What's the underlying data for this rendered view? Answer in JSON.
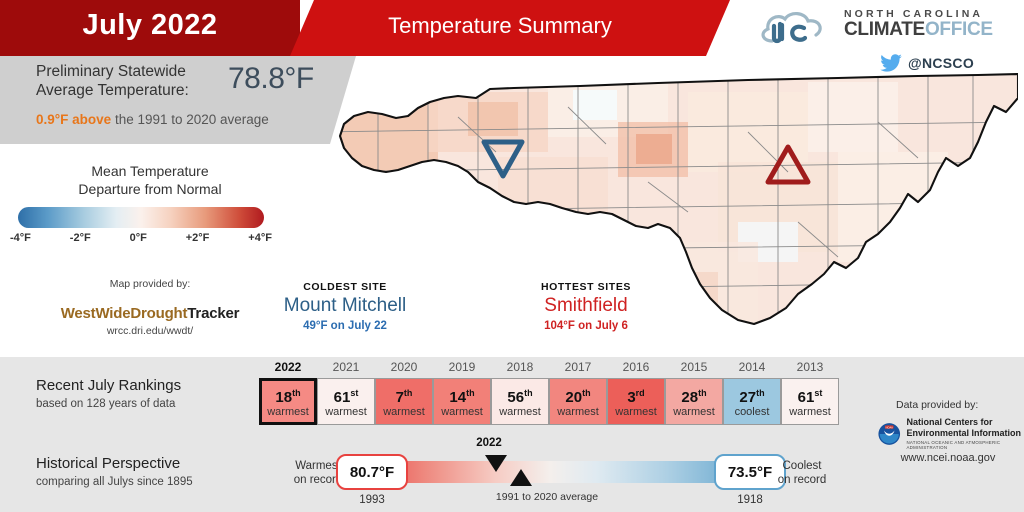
{
  "header": {
    "month_title": "July 2022",
    "banner_title": "Temperature Summary",
    "statewide_label": "Preliminary Statewide Average Temperature:",
    "statewide_value": "78.8°F",
    "departure_highlight": "0.9°F above",
    "departure_rest": " the 1991 to 2020 average"
  },
  "logo": {
    "line1": "NORTH CAROLINA",
    "climate": "CLIMATE",
    "office": "OFFICE",
    "twitter_handle": "@NCSCO",
    "twitter_icon": "twitter-bird-icon",
    "cloud_icon": "nc-cloud-logo-icon"
  },
  "legend": {
    "title_line1": "Mean Temperature",
    "title_line2": "Departure from Normal",
    "ticks": [
      "-4°F",
      "-2°F",
      "0°F",
      "+2°F",
      "+4°F"
    ],
    "provided_label": "Map provided by:",
    "provider_part1": "WestWideDrought",
    "provider_part2": "Tracker",
    "provider_url": "wrcc.dri.edu/wwdt/"
  },
  "sites": {
    "coldest": {
      "kicker": "COLDEST SITE",
      "name": "Mount Mitchell",
      "detail": "49°F on July 22",
      "marker_icon": "down-triangle-marker-icon"
    },
    "hottest": {
      "kicker": "HOTTEST SITES",
      "name": "Smithfield",
      "detail": "104°F on July 6",
      "marker_icon": "up-triangle-marker-icon"
    }
  },
  "rankings": {
    "title": "Recent July Rankings",
    "subtitle": "based on 128 years of data",
    "items": [
      {
        "year": "2022",
        "rank": "18",
        "suffix": "th",
        "word": "warmest",
        "color": "#f58a84",
        "current": true
      },
      {
        "year": "2021",
        "rank": "61",
        "suffix": "st",
        "word": "warmest",
        "color": "#faf0ee",
        "current": false
      },
      {
        "year": "2020",
        "rank": "7",
        "suffix": "th",
        "word": "warmest",
        "color": "#ef6e68",
        "current": false
      },
      {
        "year": "2019",
        "rank": "14",
        "suffix": "th",
        "word": "warmest",
        "color": "#f28078",
        "current": false
      },
      {
        "year": "2018",
        "rank": "56",
        "suffix": "th",
        "word": "warmest",
        "color": "#fbe9e6",
        "current": false
      },
      {
        "year": "2017",
        "rank": "20",
        "suffix": "th",
        "word": "warmest",
        "color": "#f2867f",
        "current": false
      },
      {
        "year": "2016",
        "rank": "3",
        "suffix": "rd",
        "word": "warmest",
        "color": "#ec5f59",
        "current": false
      },
      {
        "year": "2015",
        "rank": "28",
        "suffix": "th",
        "word": "warmest",
        "color": "#f3a8a2",
        "current": false
      },
      {
        "year": "2014",
        "rank": "27",
        "suffix": "th",
        "word": "coolest",
        "color": "#9cc8e0",
        "current": false
      },
      {
        "year": "2013",
        "rank": "61",
        "suffix": "st",
        "word": "warmest",
        "color": "#faf1ef",
        "current": false
      }
    ]
  },
  "historical": {
    "title": "Historical Perspective",
    "subtitle": "comparing all Julys since 1895",
    "warmest_label_line1": "Warmest",
    "warmest_label_line2": "on record",
    "warmest_value": "80.7°F",
    "warmest_year": "1993",
    "coolest_label_line1": "Coolest",
    "coolest_label_line2": "on record",
    "coolest_value": "73.5°F",
    "coolest_year": "1918",
    "marker_current_label": "2022",
    "marker_average_label": "1991 to 2020 average",
    "marker_current_icon": "down-triangle-icon",
    "marker_average_icon": "up-triangle-icon"
  },
  "attribution": {
    "label": "Data provided by:",
    "agency_line1": "National Centers for",
    "agency_line2": "Environmental Information",
    "agency_line3": "NATIONAL OCEANIC AND ATMOSPHERIC ADMINISTRATION",
    "url": "www.ncei.noaa.gov",
    "logo_icon": "noaa-seal-icon"
  }
}
